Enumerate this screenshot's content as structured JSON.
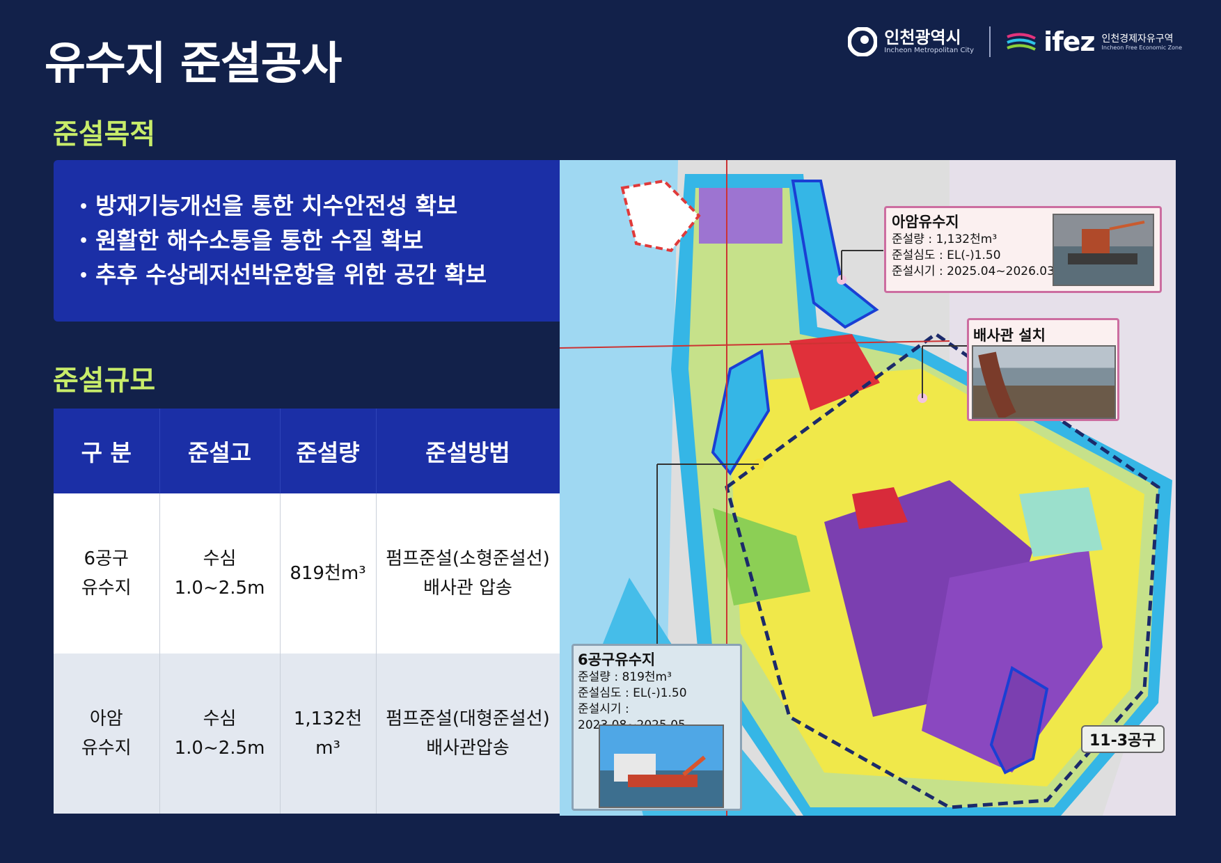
{
  "title": "유수지 준설공사",
  "logos": {
    "incheon_name": "인천광역시",
    "incheon_en": "Incheon Metropolitan City",
    "ifez_name": "ifez",
    "ifez_kr": "인천경제자유구역",
    "ifez_en": "Incheon Free Economic Zone"
  },
  "purpose": {
    "heading": "준설목적",
    "items": [
      "방재기능개선을 통한 치수안전성 확보",
      "원활한 해수소통을 통한 수질 확보",
      "추후 수상레저선박운항을 위한 공간 확보"
    ]
  },
  "scale": {
    "heading": "준설규모",
    "headers": [
      "구 분",
      "준설고",
      "준설량",
      "준설방법"
    ],
    "rows": [
      {
        "name": [
          "6공구",
          "유수지"
        ],
        "height": [
          "수심",
          "1.0~2.5m"
        ],
        "volume": "819천m³",
        "method": [
          "펌프준설(소형준설선)",
          "배사관 압송"
        ]
      },
      {
        "name": [
          "아암",
          "유수지"
        ],
        "height": [
          "수심",
          "1.0~2.5m"
        ],
        "volume": "1,132천m³",
        "method": [
          "펌프준설(대형준설선)",
          "배사관압송"
        ]
      }
    ]
  },
  "map": {
    "aam": {
      "title": "아암유수지",
      "volume": "준설량 : 1,132천m³",
      "depth": "준설심도 : EL(-)1.50",
      "period": "준설시기 : 2025.04~2026.03"
    },
    "pipe": {
      "title": "배사관 설치"
    },
    "six": {
      "title": "6공구유수지",
      "volume": "준설량 : 819천m³",
      "depth": "준설심도 : EL(-)1.50",
      "period": "준설시기 : 2023.08~2025.05"
    },
    "zone_label": "11-3공구"
  },
  "colors": {
    "background": "#12214a",
    "panel_blue": "#1b2fa6",
    "section_green": "#c8ec6a",
    "water": "#35b6e6",
    "reservoir_outline": "#1a3fd4"
  }
}
